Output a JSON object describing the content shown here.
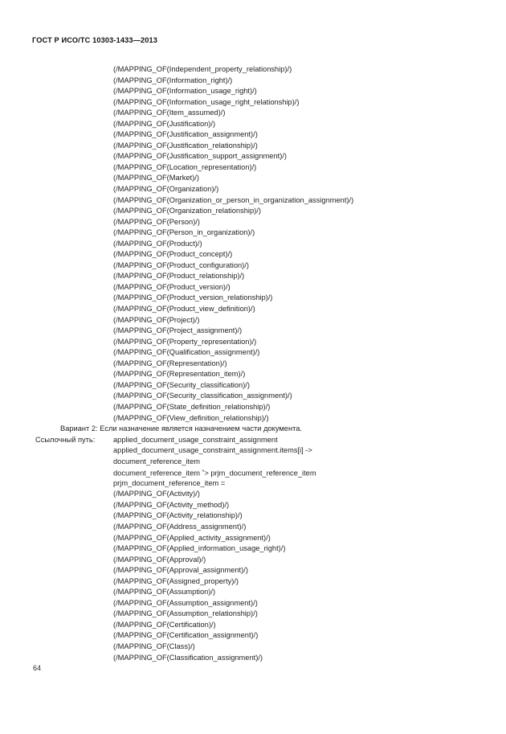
{
  "document": {
    "header": "ГОСТ Р ИСО/ТС 10303-1433—2013",
    "page_number": "64"
  },
  "content": {
    "mapping_block_1": [
      "(/MAPPING_OF(Independent_property_relationship)/)",
      "(/MAPPING_OF(Information_right)/)",
      "(/MAPPING_OF(Information_usage_right)/)",
      "(/MAPPING_OF(Information_usage_right_relationship)/)",
      "(/MAPPING_OF(Item_assumed)/)",
      "(/MAPPING_OF(Justification)/)",
      "(/MAPPING_OF(Justification_assignment)/)",
      "(/MAPPING_OF(Justification_relationship)/)",
      "(/MAPPING_OF(Justification_support_assignment)/)",
      "(/MAPPING_OF(Location_representation)/)",
      "(/MAPPING_OF(Market)/)",
      "(/MAPPING_OF(Organization)/)",
      "(/MAPPING_OF(Organization_or_person_in_organization_assignment)/)",
      "(/MAPPING_OF(Organization_relationship)/)",
      "(/MAPPING_OF(Person)/)",
      "(/MAPPING_OF(Person_in_organization)/)",
      "(/MAPPING_OF(Product)/)",
      "(/MAPPING_OF(Product_concept)/)",
      "(/MAPPING_OF(Product_configuration)/)",
      "(/MAPPING_OF(Product_relationship)/)",
      "(/MAPPING_OF(Product_version)/)",
      "(/MAPPING_OF(Product_version_relationship)/)",
      "(/MAPPING_OF(Product_view_definition)/)",
      "(/MAPPING_OF(Project)/)",
      "(/MAPPING_OF(Project_assignment)/)",
      "(/MAPPING_OF(Property_representation)/)",
      "(/MAPPING_OF(Qualification_assignment)/)",
      "(/MAPPING_OF(Representation)/)",
      "(/MAPPING_OF(Representation_item)/)",
      "(/MAPPING_OF(Security_classification)/)",
      "(/MAPPING_OF(Security_classification_assignment)/)",
      "(/MAPPING_OF(State_definition_relationship)/)",
      "(/MAPPING_OF(View_definition_relationship)/)"
    ],
    "variant_line": "Вариант 2: Если назначение является назначением части документа.",
    "reference_path": {
      "label": "Ссылочный путь:",
      "lines": [
        "applied_document_usage_constraint_assignment",
        "applied_document_usage_constraint_assignment.items[i] ->",
        "document_reference_item"
      ],
      "star_line": {
        "before": "document_reference_item ",
        "star": "*",
        "after": "> prjm_document_reference_item"
      },
      "equals_line": "prjm_document_reference_item ="
    },
    "mapping_block_2": [
      "(/MAPPING_OF(Activity)/)",
      "(/MAPPING_OF(Activity_method)/)",
      "(/MAPPING_OF(Activity_relationship)/)",
      "(/MAPPING_OF(Address_assignment)/)",
      "(/MAPPING_OF(Applied_activity_assignment)/)",
      "(/MAPPING_OF(Applied_information_usage_right)/)",
      "(/MAPPING_OF(Approval)/)",
      "(/MAPPING_OF(Approval_assignment)/)",
      "(/MAPPING_OF(Assigned_property)/)",
      "(/MAPPING_OF(Assumption)/)",
      "(/MAPPING_OF(Assumption_assignment)/)",
      "(/MAPPING_OF(Assumption_relationship)/)",
      "(/MAPPING_OF(Certification)/)",
      "(/MAPPING_OF(Certification_assignment)/)",
      "(/MAPPING_OF(Class)/)",
      "(/MAPPING_OF(Classification_assignment)/)"
    ]
  }
}
